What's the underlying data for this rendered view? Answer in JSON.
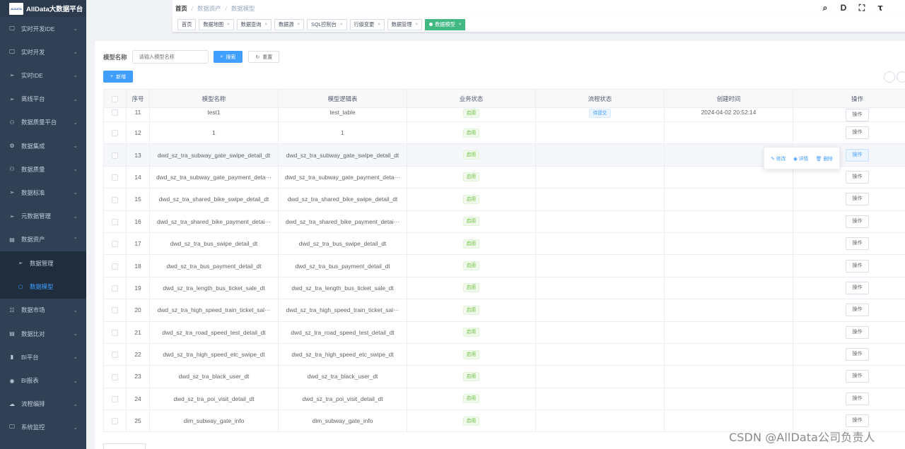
{
  "app": {
    "logo_mark": "ALDATA",
    "title": "AllData大数据平台"
  },
  "sidebar": {
    "items": [
      {
        "label": "实时开发IDE",
        "icon": "monitor-icon",
        "glyph": "🖵"
      },
      {
        "label": "实时开发",
        "icon": "monitor-icon",
        "glyph": "🖵"
      },
      {
        "label": "实时IDE",
        "icon": "send-icon",
        "glyph": "➢"
      },
      {
        "label": "离线平台",
        "icon": "send-icon",
        "glyph": "➢"
      },
      {
        "label": "数据质量平台",
        "icon": "user-icon",
        "glyph": "⚇"
      },
      {
        "label": "数据集成",
        "icon": "integration-icon",
        "glyph": "⚙"
      },
      {
        "label": "数据质量",
        "icon": "user-icon",
        "glyph": "⚇"
      },
      {
        "label": "数据标准",
        "icon": "send-icon",
        "glyph": "➢"
      },
      {
        "label": "元数据管理",
        "icon": "send-icon",
        "glyph": "➢"
      },
      {
        "label": "数据资产",
        "icon": "asset-icon",
        "glyph": "▤"
      }
    ],
    "sub_items": [
      {
        "label": "数据管理",
        "icon": "send-icon",
        "glyph": "➢"
      },
      {
        "label": "数据模型",
        "icon": "cube-icon",
        "glyph": "⬡"
      }
    ],
    "items_after": [
      {
        "label": "数据市场",
        "icon": "market-icon",
        "glyph": "☷"
      },
      {
        "label": "数据比对",
        "icon": "compare-icon",
        "glyph": "▤"
      },
      {
        "label": "BI平台",
        "icon": "bar-chart-icon",
        "glyph": "▮"
      },
      {
        "label": "BI报表",
        "icon": "report-icon",
        "glyph": "◉"
      },
      {
        "label": "流程编排",
        "icon": "cloud-icon",
        "glyph": "☁"
      },
      {
        "label": "系统监控",
        "icon": "monitor-icon",
        "glyph": "🖵"
      }
    ]
  },
  "breadcrumb": {
    "home": "首页",
    "parent": "数据资产",
    "current": "数据模型",
    "separator": "/"
  },
  "header_icons": [
    {
      "name": "search-icon",
      "glyph": "⌕"
    },
    {
      "name": "document-icon",
      "glyph": "D"
    },
    {
      "name": "fullscreen-icon",
      "glyph": "⛶"
    },
    {
      "name": "font-size-icon",
      "glyph": "ꚍ"
    }
  ],
  "tags": [
    {
      "label": "首页",
      "closable": false,
      "active": false
    },
    {
      "label": "数据地图",
      "closable": true,
      "active": false
    },
    {
      "label": "数据查询",
      "closable": true,
      "active": false
    },
    {
      "label": "数据源",
      "closable": true,
      "active": false
    },
    {
      "label": "SQL控制台",
      "closable": true,
      "active": false
    },
    {
      "label": "行级变更",
      "closable": true,
      "active": false
    },
    {
      "label": "数据管理",
      "closable": true,
      "active": false
    },
    {
      "label": "数据模型",
      "closable": true,
      "active": true
    }
  ],
  "search": {
    "label": "模型名称",
    "placeholder": "请输入模型名称",
    "search_btn": "搜索",
    "reset_btn": "重置"
  },
  "toolbar": {
    "add_btn": "新增"
  },
  "table": {
    "headers": [
      "序号",
      "模型名称",
      "模型逻辑表",
      "业务状态",
      "流程状态",
      "创建时间",
      "操作"
    ],
    "rows": [
      {
        "no": "11",
        "name": "test1",
        "table": "test_table",
        "status": "启用",
        "flow": "待提交",
        "time": "2024-04-02 20:52:14",
        "op": "操作"
      },
      {
        "no": "12",
        "name": "1",
        "table": "1",
        "status": "启用",
        "flow": "",
        "time": "",
        "op": "操作"
      },
      {
        "no": "13",
        "name": "dwd_sz_tra_subway_gate_swipe_detail_dt",
        "table": "dwd_sz_tra_subway_gate_swipe_detail_dt",
        "status": "启用",
        "flow": "",
        "time": "",
        "op": "操作"
      },
      {
        "no": "14",
        "name": "dwd_sz_tra_subway_gate_payment_deta···",
        "table": "dwd_sz_tra_subway_gate_payment_deta···",
        "status": "启用",
        "flow": "",
        "time": "",
        "op": "操作"
      },
      {
        "no": "15",
        "name": "dwd_sz_tra_shared_bike_swipe_detail_dt",
        "table": "dwd_sz_tra_shared_bike_swipe_detail_dt",
        "status": "启用",
        "flow": "",
        "time": "",
        "op": "操作"
      },
      {
        "no": "16",
        "name": "dwd_sz_tra_shared_bike_payment_detai···",
        "table": "dwd_sz_tra_shared_bike_payment_detai···",
        "status": "启用",
        "flow": "",
        "time": "",
        "op": "操作"
      },
      {
        "no": "17",
        "name": "dwd_sz_tra_bus_swipe_detail_dt",
        "table": "dwd_sz_tra_bus_swipe_detail_dt",
        "status": "启用",
        "flow": "",
        "time": "",
        "op": "操作"
      },
      {
        "no": "18",
        "name": "dwd_sz_tra_bus_payment_detail_dt",
        "table": "dwd_sz_tra_bus_payment_detail_dt",
        "status": "启用",
        "flow": "",
        "time": "",
        "op": "操作"
      },
      {
        "no": "19",
        "name": "dwd_sz_tra_length_bus_ticket_sale_dt",
        "table": "dwd_sz_tra_length_bus_ticket_sale_dt",
        "status": "启用",
        "flow": "",
        "time": "",
        "op": "操作"
      },
      {
        "no": "20",
        "name": "dwd_sz_tra_high_speed_train_ticket_sal···",
        "table": "dwd_sz_tra_high_speed_train_ticket_sal···",
        "status": "启用",
        "flow": "",
        "time": "",
        "op": "操作"
      },
      {
        "no": "21",
        "name": "dwd_sz_tra_road_speed_test_detail_dt",
        "table": "dwd_sz_tra_road_speed_test_detail_dt",
        "status": "启用",
        "flow": "",
        "time": "",
        "op": "操作"
      },
      {
        "no": "22",
        "name": "dwd_sz_tra_high_speed_etc_swipe_dt",
        "table": "dwd_sz_tra_high_speed_etc_swipe_dt",
        "status": "启用",
        "flow": "",
        "time": "",
        "op": "操作"
      },
      {
        "no": "23",
        "name": "dwd_sz_tra_black_user_dt",
        "table": "dwd_sz_tra_black_user_dt",
        "status": "启用",
        "flow": "",
        "time": "",
        "op": "操作"
      },
      {
        "no": "24",
        "name": "dwd_sz_tra_poi_visit_detail_dt",
        "table": "dwd_sz_tra_poi_visit_detail_dt",
        "status": "启用",
        "flow": "",
        "time": "",
        "op": "操作"
      },
      {
        "no": "25",
        "name": "dim_subway_gate_info",
        "table": "dim_subway_gate_info",
        "status": "启用",
        "flow": "",
        "time": "",
        "op": "操作"
      }
    ]
  },
  "popover": {
    "edit": "修改",
    "detail": "详情",
    "delete": "删除"
  },
  "watermark": "CSDN @AllData公司负责人",
  "colors": {
    "sidebar_bg": "#304156",
    "accent": "#409eff",
    "active_tag": "#42b983"
  }
}
